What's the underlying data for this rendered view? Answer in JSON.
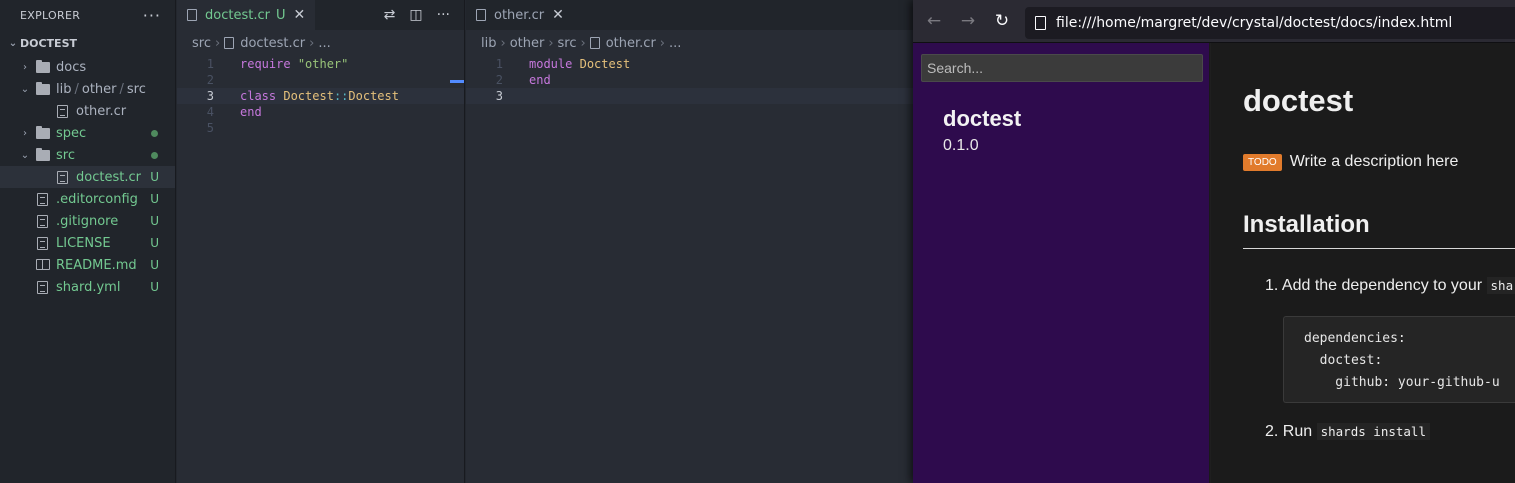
{
  "explorer": {
    "title": "EXPLORER",
    "more_label": "···",
    "project": "DOCTEST",
    "items": [
      {
        "label": "docs",
        "type": "folder",
        "expanded": false,
        "status": ""
      },
      {
        "label_parts": [
          "lib",
          "other",
          "src"
        ],
        "type": "folder",
        "expanded": true,
        "status": ""
      },
      {
        "label": "other.cr",
        "type": "file",
        "status": ""
      },
      {
        "label": "spec",
        "type": "folder",
        "expanded": false,
        "status": "dot"
      },
      {
        "label": "src",
        "type": "folder",
        "expanded": true,
        "status": "dot"
      },
      {
        "label": "doctest.cr",
        "type": "file",
        "status": "U",
        "selected": true
      },
      {
        "label": ".editorconfig",
        "type": "file",
        "status": "U"
      },
      {
        "label": ".gitignore",
        "type": "file",
        "status": "U"
      },
      {
        "label": "LICENSE",
        "type": "file",
        "status": "U"
      },
      {
        "label": "README.md",
        "type": "file",
        "status": "U"
      },
      {
        "label": "shard.yml",
        "type": "file",
        "status": "U"
      }
    ]
  },
  "editor_left": {
    "tab_label": "doctest.cr",
    "tab_status": "U",
    "close_label": "✕",
    "breadcrumb": [
      "src",
      "doctest.cr",
      "..."
    ],
    "line_numbers": [
      "1",
      "2",
      "3",
      "4",
      "5"
    ],
    "lines": {
      "l1_kw": "require",
      "l1_str": "\"other\"",
      "l3_kw": "class",
      "l3_type1": "Doctest",
      "l3_op": "::",
      "l3_type2": "Doctest",
      "l4_kw": "end"
    }
  },
  "editor_right": {
    "tab_label": "other.cr",
    "close_label": "✕",
    "breadcrumb": [
      "lib",
      "other",
      "src",
      "other.cr",
      "..."
    ],
    "line_numbers": [
      "1",
      "2",
      "3"
    ],
    "lines": {
      "l1_kw": "module",
      "l1_type": "Doctest",
      "l2_kw": "end"
    }
  },
  "browser": {
    "back_icon": "←",
    "forward_icon": "→",
    "reload_icon": "↻",
    "url": "file:///home/margret/dev/crystal/doctest/docs/index.html",
    "search_placeholder": "Search...",
    "project_name": "doctest",
    "version": "0.1.0",
    "page_title": "doctest",
    "todo_badge": "TODO",
    "todo_text": "Write a description here",
    "installation_heading": "Installation",
    "step1_text": "Add the dependency to your",
    "step1_code": "shard",
    "code_lines": [
      "dependencies:",
      "  doctest:",
      "    github: your-github-u"
    ],
    "step2_text": "Run",
    "step2_code": "shards install"
  },
  "colors": {
    "git_untracked": "#73c991",
    "docs_sidebar": "#2e0b4d",
    "todo_badge": "#e17b2c"
  }
}
